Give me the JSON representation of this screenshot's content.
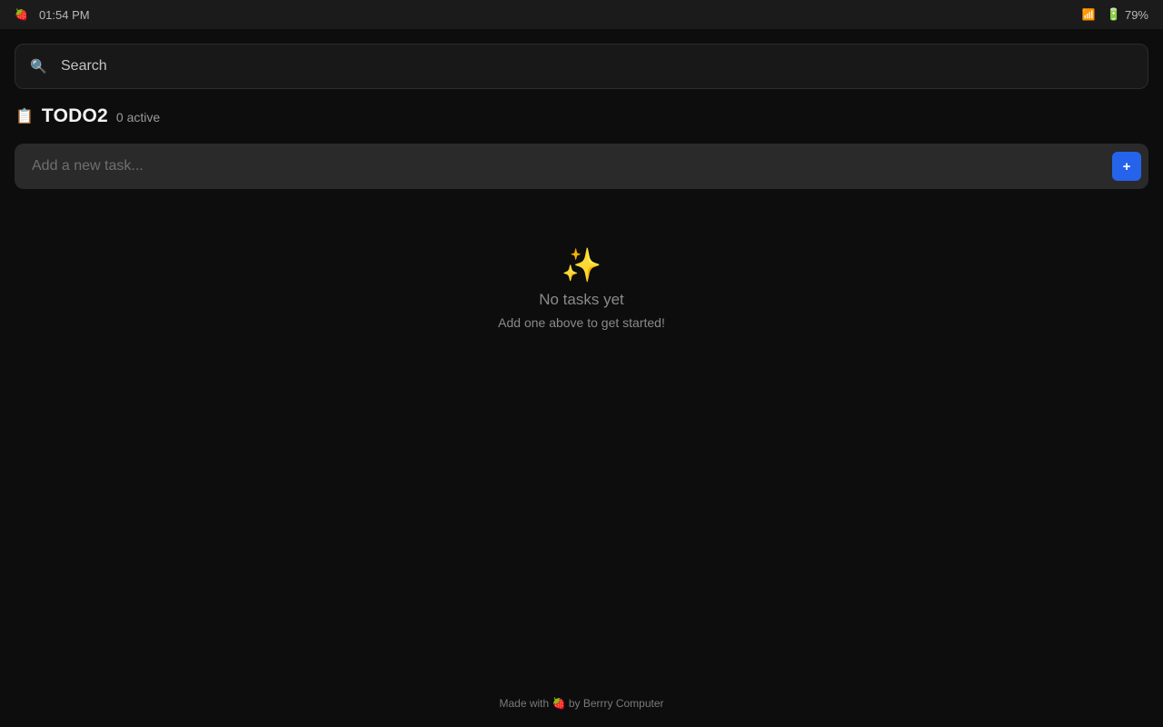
{
  "status_bar": {
    "app_icon": "strawberry-icon",
    "time": "01:54 PM",
    "wifi_icon": "wifi-icon",
    "battery_icon": "battery-icon",
    "battery_percent": "79%"
  },
  "search": {
    "icon": "search-icon",
    "placeholder": "Search"
  },
  "header": {
    "icon": "clipboard-icon",
    "title": "TODO2",
    "active_count": "0 active"
  },
  "add_task": {
    "placeholder": "Add a new task...",
    "button_label": "+",
    "button_color": "#2563eb"
  },
  "empty_state": {
    "icon": "sparkles-icon",
    "title": "No tasks yet",
    "subtitle": "Add one above to get started!"
  },
  "footer": {
    "prefix": "Made with",
    "icon": "strawberry-icon",
    "suffix": "by Berrry Computer"
  }
}
